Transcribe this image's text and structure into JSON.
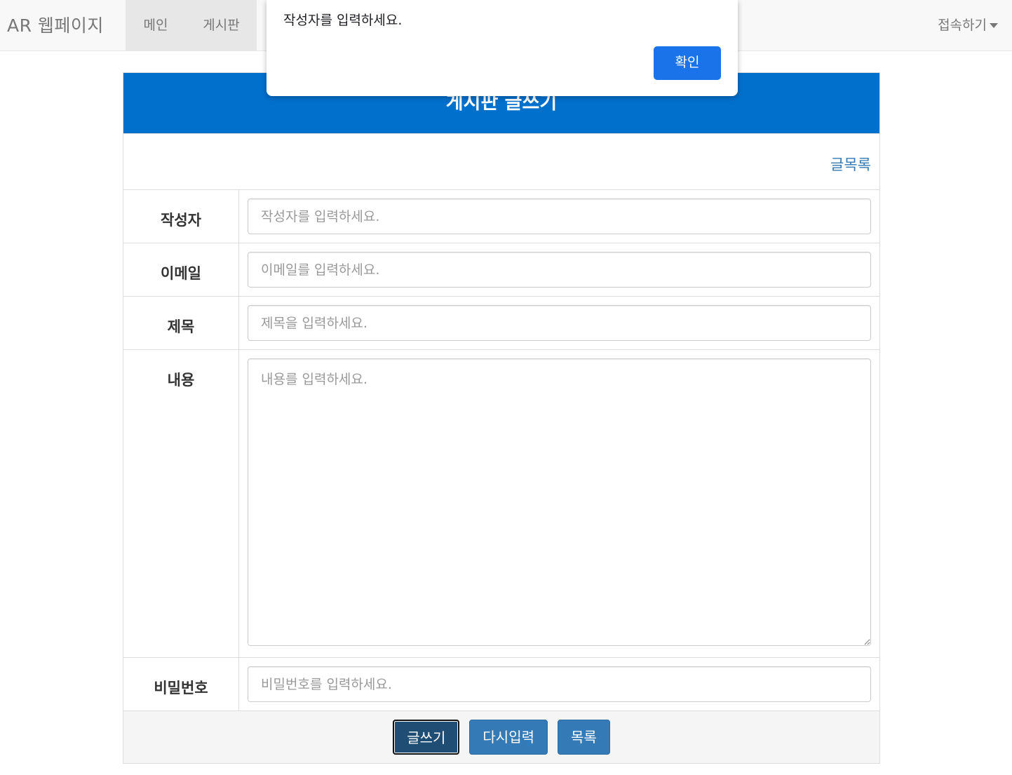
{
  "navbar": {
    "brand": "AR 웹페이지",
    "items": [
      {
        "label": "메인"
      },
      {
        "label": "게시판"
      }
    ],
    "right_menu": "접속하기"
  },
  "form": {
    "header": "게시판 글쓰기",
    "list_link": "글목록",
    "fields": {
      "author": {
        "label": "작성자",
        "placeholder": "작성자를 입력하세요."
      },
      "email": {
        "label": "이메일",
        "placeholder": "이메일를 입력하세요."
      },
      "subject": {
        "label": "제목",
        "placeholder": "제목을 입력하세요."
      },
      "content": {
        "label": "내용",
        "placeholder": "내용를 입력하세요."
      },
      "password": {
        "label": "비밀번호",
        "placeholder": "비밀번호를 입력하세요."
      }
    },
    "buttons": {
      "write": "글쓰기",
      "reset": "다시입력",
      "list": "목록"
    }
  },
  "dialog": {
    "message": "작성자를 입력하세요.",
    "ok_label": "확인"
  },
  "colors": {
    "header_bg": "#0070cd",
    "button_bg": "#337ab7",
    "dialog_button": "#1a73e8"
  }
}
